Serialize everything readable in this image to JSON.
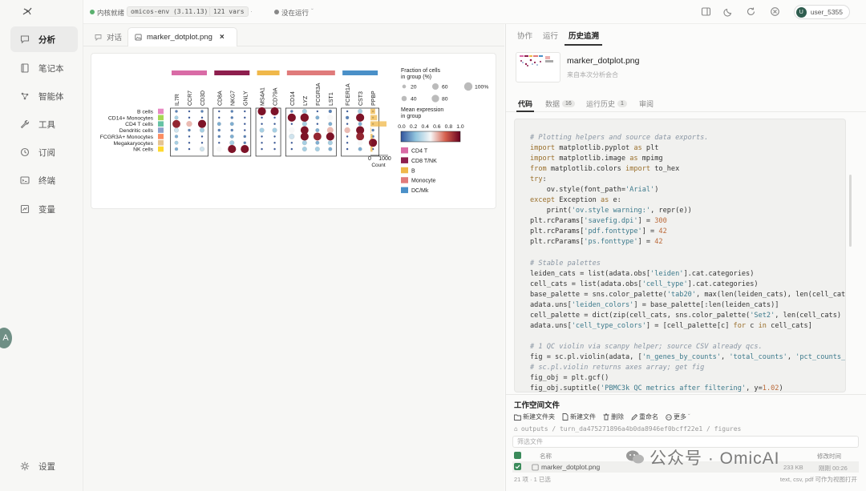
{
  "sidebar": {
    "items": [
      {
        "label": "分析",
        "icon": "chat-bubble-icon"
      },
      {
        "label": "笔记本",
        "icon": "notebook-icon"
      },
      {
        "label": "智能体",
        "icon": "agent-icon"
      },
      {
        "label": "工具",
        "icon": "wrench-icon"
      },
      {
        "label": "订阅",
        "icon": "subscribe-icon"
      },
      {
        "label": "终端",
        "icon": "terminal-icon"
      },
      {
        "label": "变量",
        "icon": "variables-icon"
      }
    ],
    "settings_label": "设置",
    "avatar_letter": "A"
  },
  "topbar": {
    "kernel_status": "内核就绪",
    "env_name": "omicos-env (3.11.13)",
    "vars_count": "121 vars",
    "run_status": "没在运行",
    "username": "user_5355",
    "user_initial": "U"
  },
  "left_tabs": [
    {
      "label": "对话"
    },
    {
      "label": "marker_dotplot.png"
    }
  ],
  "right_panel": {
    "tabs": [
      "协作",
      "运行",
      "历史追溯"
    ],
    "file_title": "marker_dotplot.png",
    "file_subtitle": "来自本次分析会合",
    "subtabs": [
      {
        "label": "代码"
      },
      {
        "label": "数据",
        "badge": "16"
      },
      {
        "label": "运行历史",
        "badge": "1"
      },
      {
        "label": "审阅"
      }
    ],
    "code_lines": [
      [
        {
          "t": "# Plotting helpers and source data exports.",
          "c": "cm"
        }
      ],
      [
        {
          "t": "import",
          "c": "kw"
        },
        {
          "t": " matplotlib.pyplot "
        },
        {
          "t": "as",
          "c": "kw"
        },
        {
          "t": " plt"
        }
      ],
      [
        {
          "t": "import",
          "c": "kw"
        },
        {
          "t": " matplotlib.image "
        },
        {
          "t": "as",
          "c": "kw"
        },
        {
          "t": " mpimg"
        }
      ],
      [
        {
          "t": "from",
          "c": "kw"
        },
        {
          "t": " matplotlib.colors "
        },
        {
          "t": "import",
          "c": "kw"
        },
        {
          "t": " to_hex"
        }
      ],
      [
        {
          "t": "try",
          "c": "kw"
        },
        {
          "t": ":"
        }
      ],
      [
        {
          "t": "    ov.style(font_path="
        },
        {
          "t": "'Arial'",
          "c": "st"
        },
        {
          "t": ")"
        }
      ],
      [
        {
          "t": "except",
          "c": "kw"
        },
        {
          "t": " Exception "
        },
        {
          "t": "as",
          "c": "kw"
        },
        {
          "t": " e:"
        }
      ],
      [
        {
          "t": "    print("
        },
        {
          "t": "'ov.style warning:'",
          "c": "st"
        },
        {
          "t": ", repr(e))"
        }
      ],
      [
        {
          "t": "plt.rcParams["
        },
        {
          "t": "'savefig.dpi'",
          "c": "st"
        },
        {
          "t": "] = "
        },
        {
          "t": "300",
          "c": "nm"
        }
      ],
      [
        {
          "t": "plt.rcParams["
        },
        {
          "t": "'pdf.fonttype'",
          "c": "st"
        },
        {
          "t": "] = "
        },
        {
          "t": "42",
          "c": "nm"
        }
      ],
      [
        {
          "t": "plt.rcParams["
        },
        {
          "t": "'ps.fonttype'",
          "c": "st"
        },
        {
          "t": "] = "
        },
        {
          "t": "42",
          "c": "nm"
        }
      ],
      [
        {
          "t": ""
        }
      ],
      [
        {
          "t": "# Stable palettes",
          "c": "cm"
        }
      ],
      [
        {
          "t": "leiden_cats = list(adata.obs["
        },
        {
          "t": "'leiden'",
          "c": "st"
        },
        {
          "t": "].cat.categories)"
        }
      ],
      [
        {
          "t": "cell_cats = list(adata.obs["
        },
        {
          "t": "'cell_type'",
          "c": "st"
        },
        {
          "t": "].cat.categories)"
        }
      ],
      [
        {
          "t": "base_palette = sns.color_palette("
        },
        {
          "t": "'tab20'",
          "c": "st"
        },
        {
          "t": ", max(len(leiden_cats), len(cell_cat"
        }
      ],
      [
        {
          "t": "adata.uns["
        },
        {
          "t": "'leiden_colors'",
          "c": "st"
        },
        {
          "t": "] = base_palette[:len(leiden_cats)]"
        }
      ],
      [
        {
          "t": "cell_palette = dict(zip(cell_cats, sns.color_palette("
        },
        {
          "t": "'Set2'",
          "c": "st"
        },
        {
          "t": ", len(cell_cats)"
        }
      ],
      [
        {
          "t": "adata.uns["
        },
        {
          "t": "'cell_type_colors'",
          "c": "st"
        },
        {
          "t": "] = [cell_palette[c] "
        },
        {
          "t": "for",
          "c": "kw"
        },
        {
          "t": " c "
        },
        {
          "t": "in",
          "c": "kw"
        },
        {
          "t": " cell_cats]"
        }
      ],
      [
        {
          "t": ""
        }
      ],
      [
        {
          "t": "# 1 QC violin via scanpy helper; source CSV already qcs.",
          "c": "cm"
        }
      ],
      [
        {
          "t": "fig = sc.pl.violin(adata, ["
        },
        {
          "t": "'n_genes_by_counts'",
          "c": "st"
        },
        {
          "t": ", "
        },
        {
          "t": "'total_counts'",
          "c": "st"
        },
        {
          "t": ", "
        },
        {
          "t": "'pct_counts_",
          "c": "st"
        }
      ],
      [
        {
          "t": "# sc.pl.violin returns axes array; get fig",
          "c": "cm"
        }
      ],
      [
        {
          "t": "fig_obj = plt.gcf()"
        }
      ],
      [
        {
          "t": "fig_obj.suptitle("
        },
        {
          "t": "'PBMC3k QC metrics after filtering'",
          "c": "st"
        },
        {
          "t": ", y="
        },
        {
          "t": "1.02",
          "c": "nm"
        },
        {
          "t": ")"
        }
      ]
    ],
    "workspace": {
      "title": "工作空间文件",
      "actions": [
        "新建文件夹",
        "新建文件",
        "删除",
        "重命名",
        "更多"
      ],
      "path": "outputs / turn_da475271896a4b0da8946ef0bcff22e1 / figures",
      "path_last": "figures",
      "filter_placeholder": "筛选文件",
      "col_name": "名称",
      "col_modified": "修改时间",
      "file_name": "marker_dotplot.png",
      "file_size": "233 KB",
      "file_time": "刚刚 00:26",
      "footer_left": "21 项 · 1 已选",
      "footer_right": "text, csv, pdf 可作为视图打开"
    }
  },
  "watermark": "公众号 · OmicAI",
  "colors": {
    "accent_green": "#2f5d4f",
    "check_green": "#3a8a5a",
    "status_green": "#5ab06e",
    "warn_red": "#c0392b"
  },
  "chart_data": {
    "type": "dotplot",
    "title": "",
    "groups": [
      {
        "name": "CD4 T",
        "color": "#d96ba6",
        "genes": [
          "IL7R",
          "CCR7",
          "CD3D"
        ]
      },
      {
        "name": "CD8 T/NK",
        "color": "#8e1f4e",
        "genes": [
          "CD8A",
          "NKG7",
          "GNLY"
        ]
      },
      {
        "name": "B",
        "color": "#f0b84a",
        "genes": [
          "MS4A1",
          "CD79A"
        ]
      },
      {
        "name": "Monocyte",
        "color": "#e07b7b",
        "genes": [
          "CD14",
          "LYZ",
          "FCGR3A",
          "LST1"
        ]
      },
      {
        "name": "DC/Mk",
        "color": "#4a90c8",
        "genes": [
          "FCER1A",
          "CST3",
          "PPBP"
        ]
      }
    ],
    "cell_types": [
      "B cells",
      "CD14+ Monocytes",
      "CD4 T cells",
      "Dendritic cells",
      "FCGR3A+ Monocytes",
      "Megakaryocytes",
      "NK cells"
    ],
    "cell_type_colors": [
      "#e78ac3",
      "#a6d854",
      "#66c2a5",
      "#8da0cb",
      "#fc8d62",
      "#e5c494",
      "#ffd92f"
    ],
    "cell_counts": [
      340,
      480,
      1150,
      40,
      150,
      15,
      150
    ],
    "count_axis": {
      "ticks": [
        0,
        1000
      ],
      "label": "Count"
    },
    "legend": {
      "size_title": "Fraction of cells\nin group (%)",
      "size_values": [
        20,
        40,
        60,
        80,
        100
      ],
      "color_title": "Mean expression\nin group",
      "color_ticks": [
        "0.0",
        "0.2",
        "0.4",
        "0.6",
        "0.8",
        "1.0"
      ]
    },
    "fraction": [
      [
        0.1,
        0.05,
        0.1,
        0.05,
        0.1,
        0.05,
        0.95,
        0.95,
        0.1,
        0.3,
        0.05,
        0.15,
        0.05,
        0.3,
        0.05
      ],
      [
        0.2,
        0.05,
        0.05,
        0.05,
        0.1,
        0.05,
        0.05,
        0.05,
        0.95,
        1.0,
        0.2,
        0.5,
        0.15,
        0.95,
        0.05
      ],
      [
        0.9,
        0.5,
        0.95,
        0.2,
        0.2,
        0.05,
        0.05,
        0.05,
        0.05,
        0.3,
        0.05,
        0.2,
        0.05,
        0.2,
        0.05
      ],
      [
        0.3,
        0.1,
        0.3,
        0.1,
        0.1,
        0.05,
        0.3,
        0.3,
        0.5,
        0.9,
        0.2,
        0.6,
        0.5,
        0.95,
        0.1
      ],
      [
        0.15,
        0.05,
        0.05,
        0.1,
        0.2,
        0.1,
        0.05,
        0.05,
        0.4,
        0.95,
        0.9,
        0.95,
        0.05,
        0.9,
        0.1
      ],
      [
        0.2,
        0.05,
        0.05,
        0.05,
        0.3,
        0.1,
        0.05,
        0.05,
        0.05,
        0.3,
        0.2,
        0.3,
        0.05,
        0.4,
        0.95
      ],
      [
        0.15,
        0.05,
        0.3,
        0.4,
        0.95,
        0.95,
        0.05,
        0.05,
        0.05,
        0.3,
        0.3,
        0.2,
        0.05,
        0.2,
        0.05
      ]
    ],
    "expression": [
      [
        0.1,
        0.0,
        0.1,
        0.0,
        0.1,
        0.0,
        0.95,
        0.95,
        0.1,
        0.3,
        0.0,
        0.1,
        0.0,
        0.3,
        0.0
      ],
      [
        0.3,
        0.0,
        0.0,
        0.0,
        0.1,
        0.0,
        0.0,
        0.0,
        0.95,
        0.95,
        0.2,
        0.5,
        0.1,
        0.95,
        0.0
      ],
      [
        0.9,
        0.6,
        0.95,
        0.2,
        0.2,
        0.0,
        0.0,
        0.0,
        0.0,
        0.3,
        0.0,
        0.2,
        0.0,
        0.2,
        0.0
      ],
      [
        0.4,
        0.1,
        0.3,
        0.1,
        0.1,
        0.0,
        0.3,
        0.3,
        0.5,
        0.95,
        0.2,
        0.6,
        0.6,
        0.95,
        0.1
      ],
      [
        0.2,
        0.0,
        0.0,
        0.1,
        0.2,
        0.1,
        0.0,
        0.0,
        0.4,
        0.95,
        0.9,
        0.95,
        0.0,
        0.9,
        0.1
      ],
      [
        0.3,
        0.0,
        0.0,
        0.0,
        0.3,
        0.1,
        0.0,
        0.0,
        0.0,
        0.3,
        0.2,
        0.3,
        0.0,
        0.5,
        0.95
      ],
      [
        0.2,
        0.0,
        0.4,
        0.5,
        0.95,
        0.95,
        0.0,
        0.0,
        0.0,
        0.3,
        0.3,
        0.2,
        0.0,
        0.2,
        0.0
      ]
    ]
  }
}
